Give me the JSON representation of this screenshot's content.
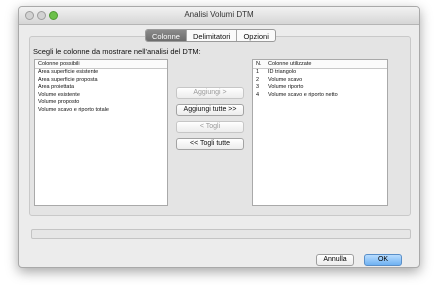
{
  "window": {
    "title": "Analisi Volumi DTM"
  },
  "tabs": [
    {
      "label": "Colonne",
      "active": true
    },
    {
      "label": "Delimitatori",
      "active": false
    },
    {
      "label": "Opzioni",
      "active": false
    }
  ],
  "instruction": "Scegli le colonne da mostrare nell'analisi del DTM:",
  "available": {
    "header": "Colonne possibili",
    "items": [
      "Area superficie esistente",
      "Area superficie proposta",
      "Area proiettata",
      "Volume esistente",
      "Volume proposto",
      "Volume scavo e riporto totale"
    ]
  },
  "used": {
    "header_n": "N.",
    "header_label": "Colonne utilizzate",
    "rows": [
      {
        "n": "1",
        "label": "ID triangolo"
      },
      {
        "n": "2",
        "label": "Volume scavo"
      },
      {
        "n": "3",
        "label": "Volume riporto"
      },
      {
        "n": "4",
        "label": "Volume scavo e riporto netto"
      }
    ]
  },
  "buttons": {
    "add": "Aggiungi >",
    "add_all": "Aggiungi tutte >>",
    "remove": "< Togli",
    "remove_all": "<< Togli tutte"
  },
  "footer": {
    "cancel": "Annulla",
    "ok": "OK"
  },
  "colors": {
    "default_button": "#6fb2f2",
    "active_tab": "#7a7a7a"
  }
}
